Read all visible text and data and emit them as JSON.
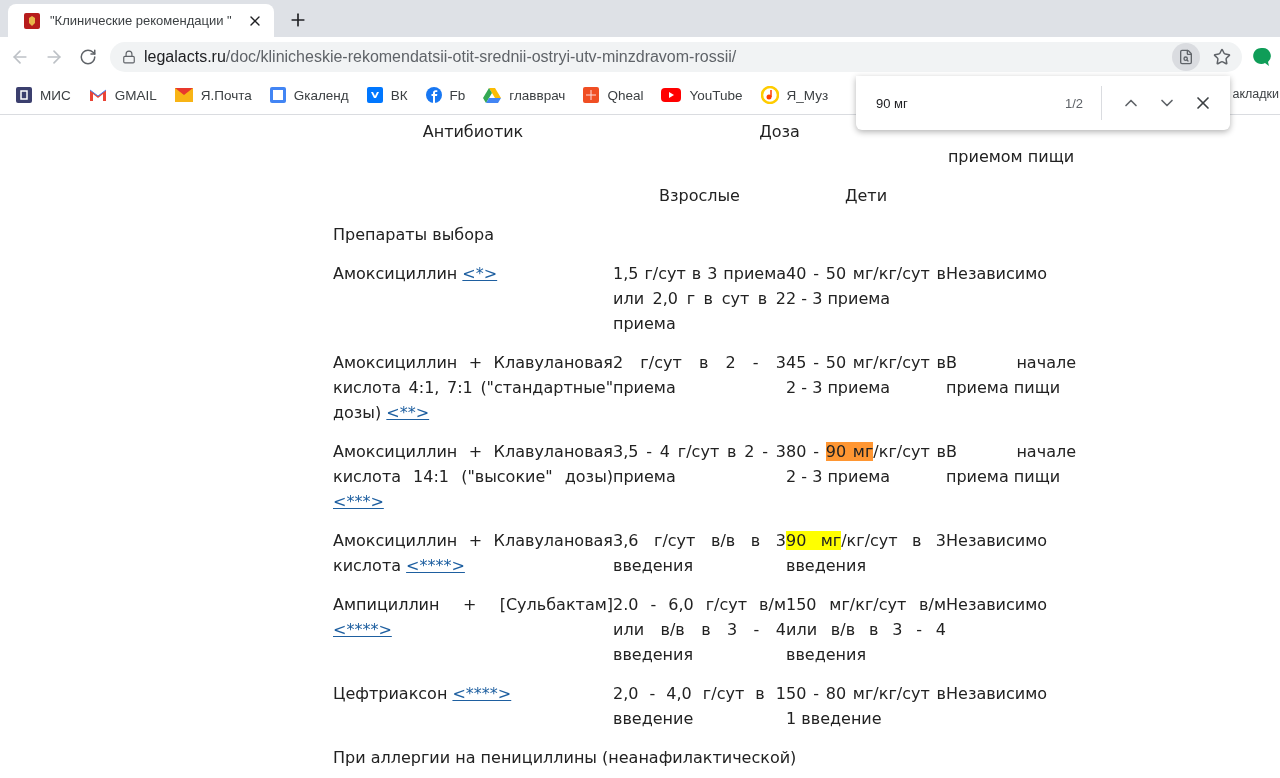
{
  "tab": {
    "title": "\"Клинические рекомендации \""
  },
  "address": {
    "host": "legalacts.ru",
    "path": "/doc/klinicheskie-rekomendatsii-otit-srednii-ostryi-utv-minzdravom-rossii/"
  },
  "bookmarks": [
    {
      "label": "МИС"
    },
    {
      "label": "GMAIL"
    },
    {
      "label": "Я.Почта"
    },
    {
      "label": "Gкаленд"
    },
    {
      "label": "ВК"
    },
    {
      "label": "Fb"
    },
    {
      "label": "главврач"
    },
    {
      "label": "Qheal"
    },
    {
      "label": "YouTube"
    },
    {
      "label": "Я_Муз"
    }
  ],
  "bookmarks_overflow": "акладки",
  "find_bar": {
    "value": "90 мг",
    "count": "1/2"
  },
  "table": {
    "header": {
      "antibiotic": "Антибиотик",
      "dose": "Доза",
      "food": "приемом пищи"
    },
    "subheader": {
      "adults": "Взрослые",
      "children": "Дети"
    },
    "section": "Препараты выбора",
    "rows": [
      {
        "antibiotic": {
          "name": "Амоксициллин",
          "ref": "<*>"
        },
        "adults": [
          {
            "text": "1,5 г/сут в 3 приема или 2,0 г в сут в 2 приема"
          }
        ],
        "children": [
          {
            "text": "40 - 50 мг/кг/сут в 2 - 3 приема"
          }
        ],
        "food": "Независимо"
      },
      {
        "antibiotic": {
          "name": "Амоксициллин + Клавулановая кислота 4:1, 7:1 (\"стандартные\" дозы)",
          "ref": "<**>"
        },
        "adults": [
          {
            "text": "2 г/сут в 2 - 3 приема"
          }
        ],
        "children": [
          {
            "text": "45 - 50 мг/кг/сут в 2 - 3 приема"
          }
        ],
        "food": "В начале приема пищи"
      },
      {
        "antibiotic": {
          "name": "Амоксициллин + Клавулановая кислота 14:1 (\"высокие\" дозы)",
          "ref": "<***>"
        },
        "adults": [
          {
            "text": "3,5 - 4 г/сут в 2 - 3 приема"
          }
        ],
        "children": [
          {
            "text": "80 - ",
            "found": false,
            "current": false
          },
          {
            "text": "90 мг",
            "found": true,
            "current": true
          },
          {
            "text": "/кг/сут в 2 - 3 приема",
            "found": false,
            "current": false
          }
        ],
        "food": "В начале приема пищи"
      },
      {
        "antibiotic": {
          "name": "Амоксициллин + Клавулановая кислота",
          "ref": "<****>"
        },
        "adults": [
          {
            "text": "3,6 г/сут в/в в 3 введения"
          }
        ],
        "children": [
          {
            "text": "90 мг",
            "found": true,
            "current": false
          },
          {
            "text": "/кг/сут в 3 введения",
            "found": false,
            "current": false
          }
        ],
        "food": "Независимо"
      },
      {
        "antibiotic": {
          "name": "Ампициллин + [Сульбактам]",
          "ref": "<****>"
        },
        "adults": [
          {
            "text": "2.0 - 6,0 г/сут в/м или в/в в 3 - 4 введения"
          }
        ],
        "children": [
          {
            "text": "150 мг/кг/сут в/м или в/в в 3 - 4 введения"
          }
        ],
        "food": "Независимо"
      },
      {
        "antibiotic": {
          "name": "Цефтриаксон",
          "ref": "<****>"
        },
        "adults": [
          {
            "text": "2,0 - 4,0 г/сут в 1 введение"
          }
        ],
        "children": [
          {
            "text": "50 - 80 мг/кг/сут в 1 введение"
          }
        ],
        "food": "Независимо"
      }
    ]
  },
  "footer_text": "При аллергии на пенициллины (неанафилактической)"
}
